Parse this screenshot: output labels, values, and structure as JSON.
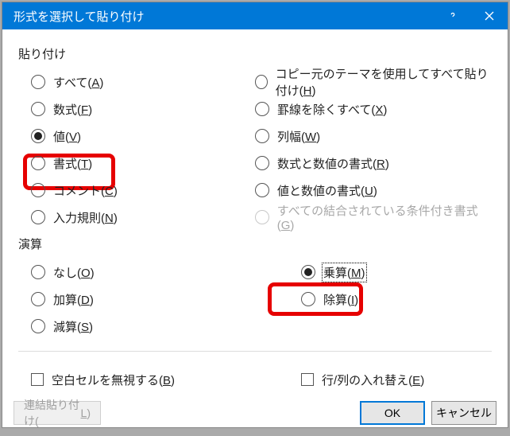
{
  "title": "形式を選択して貼り付け",
  "section_paste": "貼り付け",
  "section_op": "演算",
  "paste_left": {
    "all": {
      "pre": "すべて(",
      "u": "A",
      "post": ")"
    },
    "formula": {
      "pre": "数式(",
      "u": "F",
      "post": ")"
    },
    "value": {
      "pre": "値(",
      "u": "V",
      "post": ")"
    },
    "format": {
      "pre": "書式(",
      "u": "T",
      "post": ")"
    },
    "comment": {
      "pre": "コメント(",
      "u": "C",
      "post": ")"
    },
    "validation": {
      "pre": "入力規則(",
      "u": "N",
      "post": ")"
    }
  },
  "paste_right": {
    "theme": {
      "pre": "コピー元のテーマを使用してすべて貼り付け(",
      "u": "H",
      "post": ")"
    },
    "noborder": {
      "pre": "罫線を除くすべて(",
      "u": "X",
      "post": ")"
    },
    "width": {
      "pre": "列幅(",
      "u": "W",
      "post": ")"
    },
    "numfmt": {
      "pre": "数式と数値の書式(",
      "u": "R",
      "post": ")"
    },
    "valnumfmt": {
      "pre": "値と数値の書式(",
      "u": "U",
      "post": ")"
    },
    "condfmt": {
      "pre": "すべての結合されている条件付き書式(",
      "u": "G",
      "post": ")"
    }
  },
  "op": {
    "none": {
      "pre": "なし(",
      "u": "O",
      "post": ")"
    },
    "add": {
      "pre": "加算(",
      "u": "D",
      "post": ")"
    },
    "sub": {
      "pre": "減算(",
      "u": "S",
      "post": ")"
    },
    "mul": {
      "pre": "乗算(",
      "u": "M",
      "post": ")"
    },
    "div": {
      "pre": "除算(",
      "u": "I",
      "post": ")"
    }
  },
  "skip_blanks": {
    "pre": "空白セルを無視する(",
    "u": "B",
    "post": ")"
  },
  "transpose": {
    "pre": "行/列の入れ替え(",
    "u": "E",
    "post": ")"
  },
  "paste_link": {
    "pre": "連結貼り付け(",
    "u": "L",
    "post": ")"
  },
  "ok": "OK",
  "cancel": "キャンセル"
}
